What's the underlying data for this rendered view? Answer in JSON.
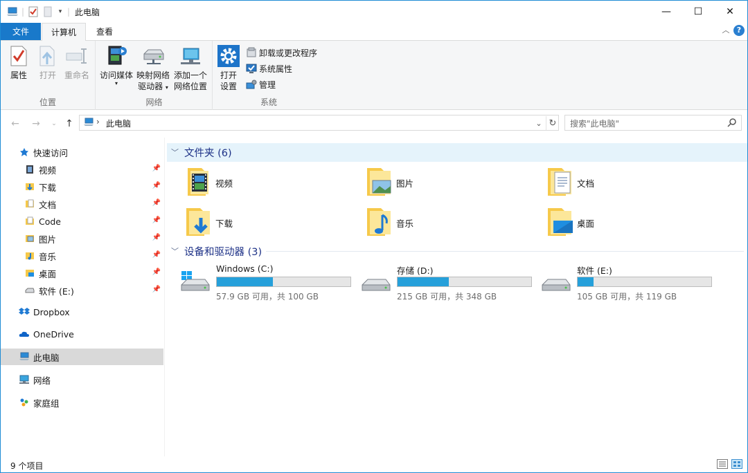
{
  "window": {
    "title": "此电脑",
    "controls": {
      "minimize": "—",
      "maximize": "☐",
      "close": "✕"
    }
  },
  "ribbon": {
    "tabs": [
      {
        "label": "文件"
      },
      {
        "label": "计算机"
      },
      {
        "label": "查看"
      }
    ],
    "groups": {
      "location": {
        "label": "位置",
        "properties": "属性",
        "open": "打开",
        "rename": "重命名"
      },
      "network": {
        "label": "网络",
        "access_media": "访问媒体",
        "map_drive_1": "映射网络",
        "map_drive_2": "驱动器",
        "add_location_1": "添加一个",
        "add_location_2": "网络位置"
      },
      "system": {
        "label": "系统",
        "open_settings_1": "打开",
        "open_settings_2": "设置",
        "uninstall": "卸载或更改程序",
        "system_properties": "系统属性",
        "manage": "管理"
      }
    }
  },
  "address": {
    "path": "此电脑",
    "search_placeholder": "搜索\"此电脑\""
  },
  "nav": {
    "quick_access": "快速访问",
    "quick_items": [
      {
        "label": "视频"
      },
      {
        "label": "下载"
      },
      {
        "label": "文档"
      },
      {
        "label": "Code"
      },
      {
        "label": "图片"
      },
      {
        "label": "音乐"
      },
      {
        "label": "桌面"
      },
      {
        "label": "软件 (E:)"
      }
    ],
    "dropbox": "Dropbox",
    "onedrive": "OneDrive",
    "this_pc": "此电脑",
    "network": "网络",
    "homegroup": "家庭组"
  },
  "content": {
    "folders_header": "文件夹 (6)",
    "folders": [
      {
        "label": "视频"
      },
      {
        "label": "图片"
      },
      {
        "label": "文档"
      },
      {
        "label": "下载"
      },
      {
        "label": "音乐"
      },
      {
        "label": "桌面"
      }
    ],
    "devices_header": "设备和驱动器 (3)",
    "drives": [
      {
        "name": "Windows (C:)",
        "free": "57.9 GB 可用，共 100 GB",
        "used_fraction": 0.421
      },
      {
        "name": "存储 (D:)",
        "free": "215 GB 可用，共 348 GB",
        "used_fraction": 0.382
      },
      {
        "name": "软件 (E:)",
        "free": "105 GB 可用，共 119 GB",
        "used_fraction": 0.118
      }
    ]
  },
  "status": {
    "items_count": "9 个项目"
  },
  "colors": {
    "accent": "#1979ca",
    "drive_bar": "#26a0da",
    "section_header": "#1e3287",
    "folder_yellow": "#f6c94a"
  }
}
